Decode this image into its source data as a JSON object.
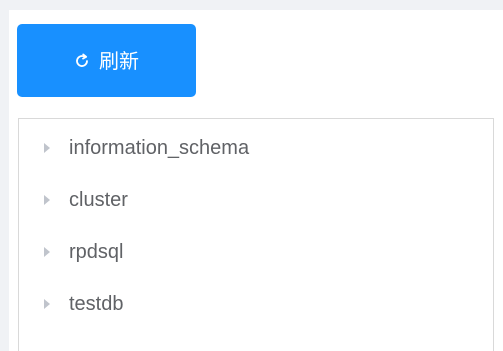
{
  "toolbar": {
    "refresh_label": "刷新",
    "refresh_icon": "refresh-icon"
  },
  "tree": {
    "nodes": [
      {
        "label": "information_schema",
        "icon": "caret-right-icon"
      },
      {
        "label": "cluster",
        "icon": "caret-right-icon"
      },
      {
        "label": "rpdsql",
        "icon": "caret-right-icon"
      },
      {
        "label": "testdb",
        "icon": "caret-right-icon"
      }
    ]
  },
  "colors": {
    "primary": "#1890ff",
    "text": "#606266",
    "border": "#d9d9d9",
    "caret": "#c0c4cc",
    "background": "#f0f2f5"
  }
}
